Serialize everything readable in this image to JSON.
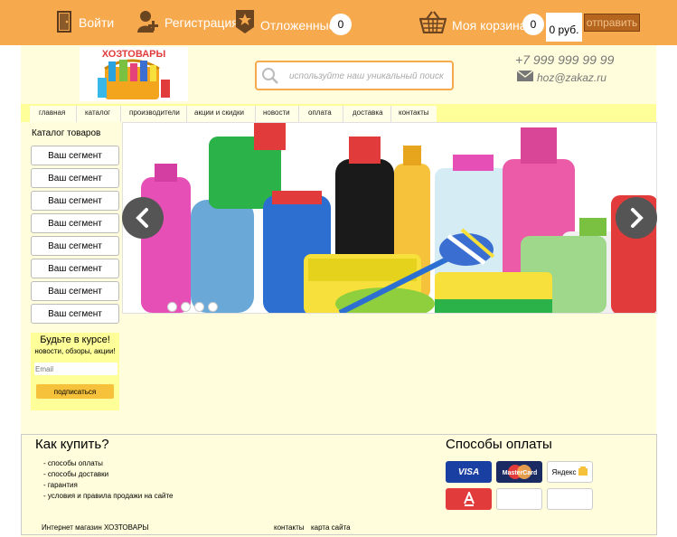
{
  "topbar": {
    "login_label": "Войти",
    "register_label": "Регистрация",
    "saved_label": "Отложенные",
    "saved_count": "0",
    "cart_label": "Моя корзина",
    "cart_count": "0",
    "cart_total": "0 руб.",
    "send_label": "отправить"
  },
  "logo": {
    "text": "ХОЗТОВАРЫ"
  },
  "search": {
    "placeholder": "используйте наш уникальный поиск"
  },
  "contact": {
    "phone": "+7 999 999 99 99",
    "email": "hoz@zakaz.ru"
  },
  "nav": {
    "items": [
      "главная",
      "каталог",
      "производители",
      "акции и скидки",
      "новости",
      "оплата",
      "доставка",
      "контакты"
    ]
  },
  "sidebar": {
    "title": "Каталог товаров",
    "segments": [
      "Ваш сегмент",
      "Ваш сегмент",
      "Ваш сегмент",
      "Ваш сегмент",
      "Ваш сегмент",
      "Ваш сегмент",
      "Ваш сегмент",
      "Ваш сегмент"
    ]
  },
  "subscribe": {
    "title": "Будьте в курсе!",
    "subtitle": "новости, обзоры, акции!",
    "email_placeholder": "Email",
    "button_label": "подписаться"
  },
  "footer": {
    "howbuy_title": "Как купить?",
    "howbuy_links": [
      "- способы оплаты",
      "- способы доставки",
      "- гарантия",
      "- условия и правила продажи на сайте"
    ],
    "payment_title": "Способы оплаты",
    "payment_labels": [
      "VISA",
      "MasterCard",
      "Яндекс"
    ],
    "shop_name": "Интернет магазин ХОЗТОВАРЫ",
    "contacts_link": "контакты",
    "sitemap_link": "карта сайта"
  },
  "colors": {
    "topbar": "#f7a94d",
    "cream": "#fffddb",
    "nav_yellow": "#ffff99",
    "send_button": "#b5651d"
  }
}
